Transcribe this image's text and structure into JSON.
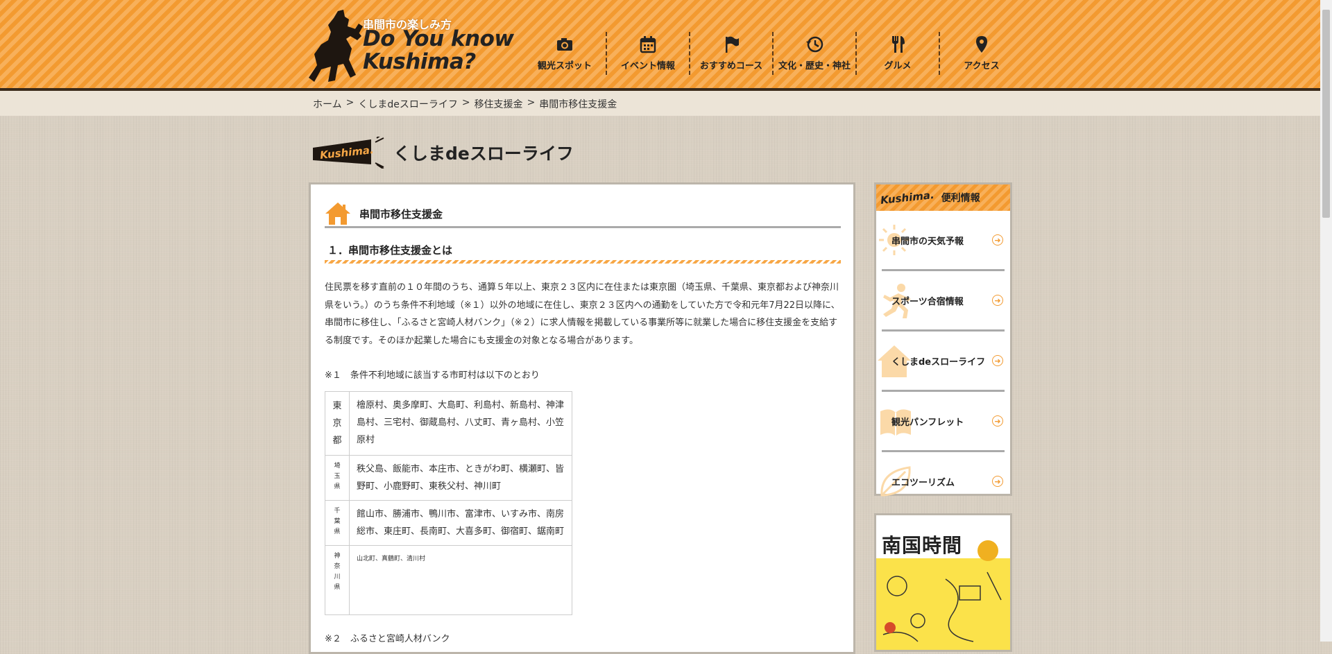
{
  "header": {
    "logo_sub": "串間市の楽しみ方",
    "logo_line1": "Do You know",
    "logo_line2": "Kushima?",
    "nav": [
      {
        "label": "観光スポット",
        "icon": "camera-icon"
      },
      {
        "label": "イベント情報",
        "icon": "calendar-icon"
      },
      {
        "label": "おすすめコース",
        "icon": "flag-icon"
      },
      {
        "label": "文化・歴史・神社",
        "icon": "history-icon"
      },
      {
        "label": "グルメ",
        "icon": "fork-knife-icon"
      },
      {
        "label": "アクセス",
        "icon": "map-pin-icon"
      }
    ]
  },
  "breadcrumb": {
    "items": [
      "ホーム",
      "くしまdeスローライフ",
      "移住支援金",
      "串間市移住支援金"
    ],
    "separator": ">"
  },
  "section": {
    "tag": "Kushima.",
    "title": "くしまdeスローライフ"
  },
  "content": {
    "page_title": "串間市移住支援金",
    "subheading": "１．串間市移住支援金とは",
    "paragraph": "住民票を移す直前の１０年間のうち、通算５年以上、東京２３区内に在住または東京圏（埼玉県、千葉県、東京都および神奈川県をいう。）のうち条件不利地域（※１）以外の地域に在住し、東京２３区内への通勤をしていた方で令和元年7月22日以降に、串間市に移住し、「ふるさと宮崎人材バンク」（※２）に求人情報を掲載している事業所等に就業した場合に移住支援金を支給する制度です。そのほか起業した場合にも支援金の対象となる場合があります。",
    "note1": "※１　条件不利地域に該当する市町村は以下のとおり",
    "table": [
      {
        "pref": [
          "東",
          "京",
          "都"
        ],
        "list": "檜原村、奥多摩町、大島町、利島村、新島村、神津島村、三宅村、御蔵島村、八丈町、青ヶ島村、小笠原村"
      },
      {
        "pref": [
          "埼",
          "玉",
          "県"
        ],
        "list": "秩父島、飯能市、本庄市、ときがわ町、横瀬町、皆野町、小鹿野町、東秩父村、神川町"
      },
      {
        "pref": [
          "千",
          "葉",
          "県"
        ],
        "list": "館山市、勝浦市、鴨川市、富津市、いすみ市、南房総市、東庄町、長南町、大喜多町、御宿町、鋸南町"
      },
      {
        "pref": [
          "神",
          "奈",
          "川",
          "県"
        ],
        "list": "山北町、真鶴町、清川村"
      }
    ],
    "note2": "※２　ふるさと宮崎人材バンク"
  },
  "sidebar": {
    "tag": "Kushima.",
    "title": "便利情報",
    "items": [
      {
        "label": "串間市の天気予報",
        "icon": "sun-icon"
      },
      {
        "label": "スポーツ合宿情報",
        "icon": "runner-icon"
      },
      {
        "label": "くしまdeスローライフ",
        "icon": "house-icon"
      },
      {
        "label": "観光パンフレット",
        "icon": "book-icon"
      },
      {
        "label": "エコツーリズム",
        "icon": "leaf-icon"
      }
    ]
  },
  "pamphlet": {
    "title": "南国時間"
  },
  "colors": {
    "accent": "#f7a746",
    "dark": "#3a2a1a",
    "background": "#d9d0c2"
  }
}
